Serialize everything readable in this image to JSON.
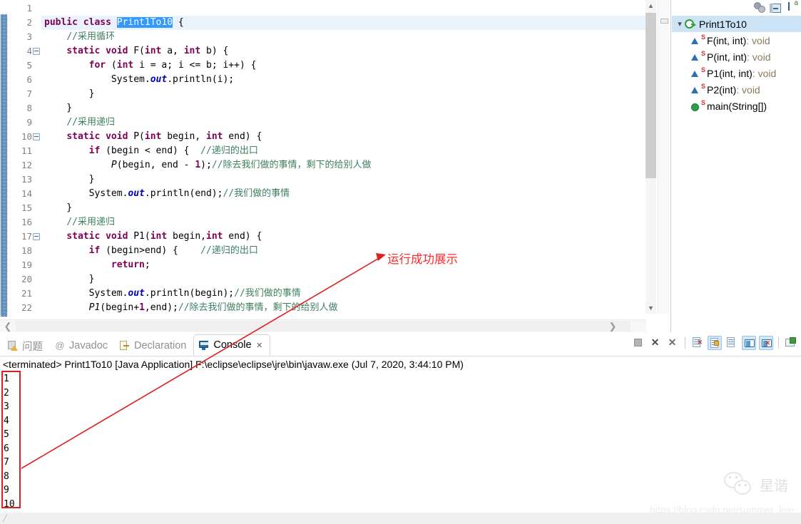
{
  "editor": {
    "lines": [
      {
        "num": "1",
        "fold": false,
        "current": false,
        "tokens": []
      },
      {
        "num": "2",
        "fold": false,
        "current": true,
        "tokens": [
          {
            "t": "kw",
            "s": "public class "
          },
          {
            "t": "sel",
            "s": "Print1To10"
          },
          {
            "t": "plain",
            "s": " {"
          }
        ]
      },
      {
        "num": "3",
        "fold": false,
        "current": false,
        "tokens": [
          {
            "t": "plain",
            "s": "    "
          },
          {
            "t": "cmt",
            "s": "//采用循环"
          }
        ]
      },
      {
        "num": "4",
        "fold": true,
        "current": false,
        "tokens": [
          {
            "t": "plain",
            "s": "    "
          },
          {
            "t": "kw",
            "s": "static void "
          },
          {
            "t": "plain",
            "s": "F("
          },
          {
            "t": "kw",
            "s": "int"
          },
          {
            "t": "plain",
            "s": " a, "
          },
          {
            "t": "kw",
            "s": "int"
          },
          {
            "t": "plain",
            "s": " b) {"
          }
        ]
      },
      {
        "num": "5",
        "fold": false,
        "current": false,
        "tokens": [
          {
            "t": "plain",
            "s": "        "
          },
          {
            "t": "kw",
            "s": "for"
          },
          {
            "t": "plain",
            "s": " ("
          },
          {
            "t": "kw",
            "s": "int"
          },
          {
            "t": "plain",
            "s": " i = a; i <= b; i++) {"
          }
        ]
      },
      {
        "num": "6",
        "fold": false,
        "current": false,
        "tokens": [
          {
            "t": "plain",
            "s": "            System."
          },
          {
            "t": "fld",
            "s": "out"
          },
          {
            "t": "plain",
            "s": ".println(i);"
          }
        ]
      },
      {
        "num": "7",
        "fold": false,
        "current": false,
        "tokens": [
          {
            "t": "plain",
            "s": "        }"
          }
        ]
      },
      {
        "num": "8",
        "fold": false,
        "current": false,
        "tokens": [
          {
            "t": "plain",
            "s": "    }"
          }
        ]
      },
      {
        "num": "9",
        "fold": false,
        "current": false,
        "tokens": [
          {
            "t": "plain",
            "s": "    "
          },
          {
            "t": "cmt",
            "s": "//采用递归"
          }
        ]
      },
      {
        "num": "10",
        "fold": true,
        "current": false,
        "tokens": [
          {
            "t": "plain",
            "s": "    "
          },
          {
            "t": "kw",
            "s": "static void "
          },
          {
            "t": "plain",
            "s": "P("
          },
          {
            "t": "kw",
            "s": "int"
          },
          {
            "t": "plain",
            "s": " begin, "
          },
          {
            "t": "kw",
            "s": "int"
          },
          {
            "t": "plain",
            "s": " end) {"
          }
        ]
      },
      {
        "num": "11",
        "fold": false,
        "current": false,
        "tokens": [
          {
            "t": "plain",
            "s": "        "
          },
          {
            "t": "kw",
            "s": "if"
          },
          {
            "t": "plain",
            "s": " (begin < end) {  "
          },
          {
            "t": "cmt",
            "s": "//递归的出口"
          }
        ]
      },
      {
        "num": "12",
        "fold": false,
        "current": false,
        "tokens": [
          {
            "t": "plain",
            "s": "            "
          },
          {
            "t": "mth",
            "s": "P"
          },
          {
            "t": "plain",
            "s": "(begin, end - "
          },
          {
            "t": "kw",
            "s": "1"
          },
          {
            "t": "plain",
            "s": ");"
          },
          {
            "t": "cmt",
            "s": "//除去我们做的事情，剩下的给别人做"
          }
        ]
      },
      {
        "num": "13",
        "fold": false,
        "current": false,
        "tokens": [
          {
            "t": "plain",
            "s": "        }"
          }
        ]
      },
      {
        "num": "14",
        "fold": false,
        "current": false,
        "tokens": [
          {
            "t": "plain",
            "s": "        System."
          },
          {
            "t": "fld",
            "s": "out"
          },
          {
            "t": "plain",
            "s": ".println(end);"
          },
          {
            "t": "cmt",
            "s": "//我们做的事情"
          }
        ]
      },
      {
        "num": "15",
        "fold": false,
        "current": false,
        "tokens": [
          {
            "t": "plain",
            "s": "    }"
          }
        ]
      },
      {
        "num": "16",
        "fold": false,
        "current": false,
        "tokens": [
          {
            "t": "plain",
            "s": "    "
          },
          {
            "t": "cmt",
            "s": "//采用递归"
          }
        ]
      },
      {
        "num": "17",
        "fold": true,
        "current": false,
        "tokens": [
          {
            "t": "plain",
            "s": "    "
          },
          {
            "t": "kw",
            "s": "static void "
          },
          {
            "t": "plain",
            "s": "P1("
          },
          {
            "t": "kw",
            "s": "int"
          },
          {
            "t": "plain",
            "s": " begin,"
          },
          {
            "t": "kw",
            "s": "int"
          },
          {
            "t": "plain",
            "s": " end) {"
          }
        ]
      },
      {
        "num": "18",
        "fold": false,
        "current": false,
        "tokens": [
          {
            "t": "plain",
            "s": "        "
          },
          {
            "t": "kw",
            "s": "if"
          },
          {
            "t": "plain",
            "s": " (begin>end) {    "
          },
          {
            "t": "cmt",
            "s": "//递归的出口"
          }
        ]
      },
      {
        "num": "19",
        "fold": false,
        "current": false,
        "tokens": [
          {
            "t": "plain",
            "s": "            "
          },
          {
            "t": "kw",
            "s": "return"
          },
          {
            "t": "plain",
            "s": ";"
          }
        ]
      },
      {
        "num": "20",
        "fold": false,
        "current": false,
        "tokens": [
          {
            "t": "plain",
            "s": "        }"
          }
        ]
      },
      {
        "num": "21",
        "fold": false,
        "current": false,
        "tokens": [
          {
            "t": "plain",
            "s": "        System."
          },
          {
            "t": "fld",
            "s": "out"
          },
          {
            "t": "plain",
            "s": ".println(begin);"
          },
          {
            "t": "cmt",
            "s": "//我们做的事情"
          }
        ]
      },
      {
        "num": "22",
        "fold": false,
        "current": false,
        "tokens": [
          {
            "t": "plain",
            "s": "        "
          },
          {
            "t": "mth",
            "s": "P1"
          },
          {
            "t": "plain",
            "s": "(begin+"
          },
          {
            "t": "kw",
            "s": "1"
          },
          {
            "t": "plain",
            "s": ",end);"
          },
          {
            "t": "cmt",
            "s": "//除去我们做的事情，剩下的给别人做"
          }
        ]
      }
    ]
  },
  "outline": {
    "toolbar": [
      {
        "name": "hide-fields-icon",
        "label": "Hide Fields"
      },
      {
        "name": "collapse-all-icon",
        "label": "Collapse All"
      },
      {
        "name": "sort-icon",
        "label": "Sort"
      }
    ],
    "root": {
      "label": "Print1To10",
      "twisty": "⌄"
    },
    "members": [
      {
        "name": "F(int, int)",
        "type": " : void",
        "vis": "prot",
        "static": "S"
      },
      {
        "name": "P(int, int)",
        "type": " : void",
        "vis": "prot",
        "static": "S"
      },
      {
        "name": "P1(int, int)",
        "type": " : void",
        "vis": "prot",
        "static": "S"
      },
      {
        "name": "P2(int)",
        "type": " : void",
        "vis": "prot",
        "static": "S"
      },
      {
        "name": "main(String[])",
        "type": "",
        "vis": "pub",
        "static": "S"
      }
    ]
  },
  "bottom": {
    "tabs": [
      {
        "label": "问题",
        "icon": "problems-icon",
        "active": false
      },
      {
        "label": "Javadoc",
        "icon": "javadoc-icon",
        "active": false
      },
      {
        "label": "Declaration",
        "icon": "declaration-icon",
        "active": false
      },
      {
        "label": "Console",
        "icon": "console-icon",
        "active": true
      }
    ],
    "tab_close": "✕",
    "console_header": "<terminated> Print1To10 [Java Application] F:\\eclipse\\eclipse\\jre\\bin\\javaw.exe (Jul 7, 2020, 3:44:10 PM)",
    "console_output": [
      "1",
      "2",
      "3",
      "4",
      "5",
      "6",
      "7",
      "8",
      "9",
      "10"
    ],
    "tools": [
      {
        "name": "terminate-button",
        "glyph": "",
        "active": false
      },
      {
        "name": "terminate-all-button",
        "glyph": "✕",
        "active": false
      },
      {
        "name": "remove-all-terminated-button",
        "glyph": "✕",
        "active": false
      },
      {
        "name": "clear-console-button",
        "glyph": "",
        "active": false
      },
      {
        "name": "scroll-lock-button",
        "glyph": "",
        "active": true
      },
      {
        "name": "pin-console-button",
        "glyph": "",
        "active": false
      },
      {
        "name": "display-selected-console-button",
        "glyph": "",
        "active": true
      },
      {
        "name": "open-console-button",
        "glyph": "",
        "active": true
      },
      {
        "name": "new-console-view-button",
        "glyph": "",
        "active": false
      }
    ]
  },
  "annotation": {
    "label": "运行成功展示",
    "color": "#ff2a2a"
  },
  "watermark": {
    "name": "星谐",
    "url": "https://blog.csdn.net/summer_lele"
  },
  "colors": {
    "keyword": "#7f0055",
    "comment": "#3f7f5f",
    "field": "#0000c0",
    "selection": "#3399ff",
    "current_line": "#eaf2fb",
    "outline_selected": "#cde4f7",
    "annotation_red": "#ff2a2a"
  }
}
